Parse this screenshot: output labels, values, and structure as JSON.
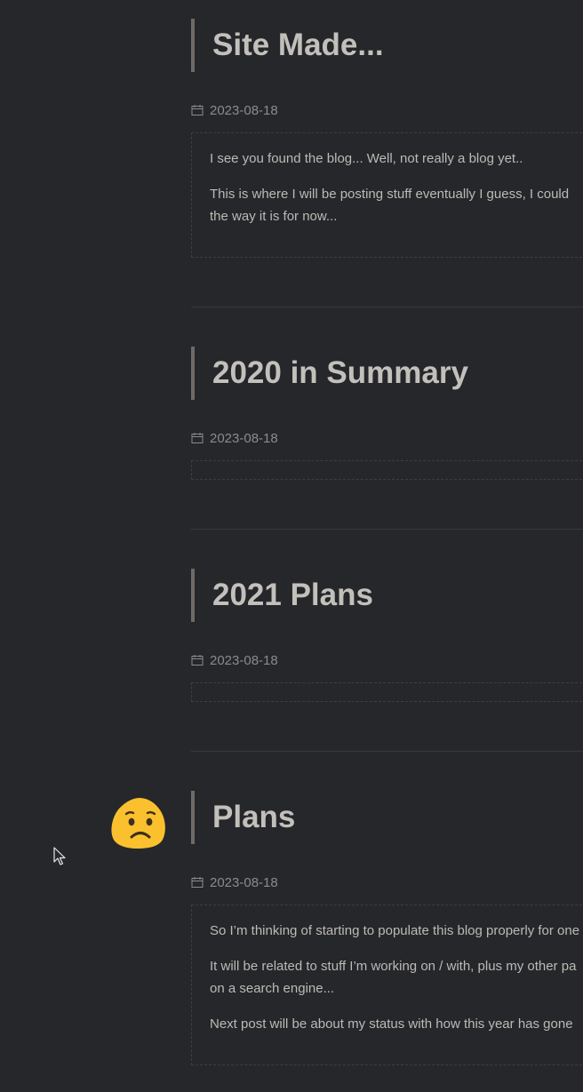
{
  "posts": [
    {
      "title": "Site Made...",
      "date": "2023-08-18",
      "paragraphs": [
        "I see you found the blog... Well, not really a blog yet..",
        "This is where I will be posting stuff eventually I guess, I could",
        "the way it is for now..."
      ]
    },
    {
      "title": "2020 in Summary",
      "date": "2023-08-18",
      "paragraphs": []
    },
    {
      "title": "2021 Plans",
      "date": "2023-08-18",
      "paragraphs": []
    },
    {
      "title": "Plans",
      "date": "2023-08-18",
      "paragraphs": [
        "So I’m thinking of starting to populate this blog properly for one",
        "It will be related to stuff I’m working on / with, plus my other pa",
        "on a search engine...",
        "Next post will be about my status with how this year has gone"
      ]
    }
  ],
  "icons": {
    "date": "calendar-icon",
    "mood": "disappointed-face-emoji",
    "pointer": "mouse-cursor"
  },
  "colors": {
    "background": "#25272a",
    "title_bar": "#6f6a65",
    "title_text": "#c3c0bc",
    "date_text": "#8b8b8b",
    "emoji_yellow": "#fbc02d"
  }
}
